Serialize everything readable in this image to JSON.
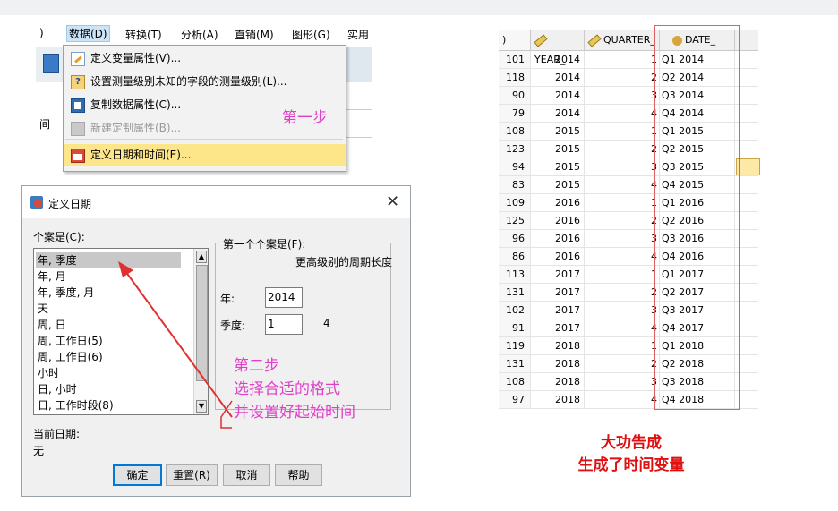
{
  "menu": {
    "bar_items": [
      ")",
      "数据(D)",
      "转换(T)",
      "分析(A)",
      "直销(M)",
      "图形(G)",
      "实用"
    ],
    "grid_label": "间",
    "dropdown_items": [
      {
        "label": "定义变量属性(V)...",
        "icon": "define-variable-properties-icon",
        "disabled": false
      },
      {
        "label": "设置测量级别未知的字段的测量级别(L)...",
        "icon": "measure-level-icon",
        "disabled": false
      },
      {
        "label": "复制数据属性(C)...",
        "icon": "copy-data-properties-icon",
        "disabled": false
      },
      {
        "label": "新建定制属性(B)...",
        "icon": "custom-attribute-icon",
        "disabled": true
      },
      {
        "label": "定义日期和时间(E)...",
        "icon": "define-dates-icon",
        "disabled": false
      }
    ],
    "step_label": "第一步"
  },
  "dialog": {
    "title": "定义日期",
    "close_glyph": "✕",
    "cases_label": "个案是(C):",
    "case_options": [
      "年, 季度",
      "年, 月",
      "年, 季度, 月",
      "天",
      "周, 日",
      "周, 工作日(5)",
      "周, 工作日(6)",
      "小时",
      "日, 小时",
      "日, 工作时段(8)"
    ],
    "selected_option": "年, 季度",
    "first_case_legend": "第一个个案是(F):",
    "higher_period_label": "更高级别的周期长度",
    "year_label": "年:",
    "year_value": "2014",
    "quarter_label": "季度:",
    "quarter_value": "1",
    "quarter_period": "4",
    "current_dates_label": "当前日期:",
    "current_dates_value": "无",
    "buttons": {
      "ok": "确定",
      "reset": "重置(R)",
      "cancel": "取消",
      "help": "帮助"
    },
    "step_lines": [
      "第二步",
      "选择合适的格式",
      "并设置好起始时间"
    ]
  },
  "grid": {
    "headers": {
      "first": ")",
      "year": "YEAR_",
      "quarter": "QUARTER_",
      "date": "DATE_"
    },
    "rows": [
      {
        "id": "101",
        "year": "2014",
        "quarter": "1",
        "date": "Q1 2014"
      },
      {
        "id": "118",
        "year": "2014",
        "quarter": "2",
        "date": "Q2 2014"
      },
      {
        "id": "90",
        "year": "2014",
        "quarter": "3",
        "date": "Q3 2014"
      },
      {
        "id": "79",
        "year": "2014",
        "quarter": "4",
        "date": "Q4 2014"
      },
      {
        "id": "108",
        "year": "2015",
        "quarter": "1",
        "date": "Q1 2015"
      },
      {
        "id": "123",
        "year": "2015",
        "quarter": "2",
        "date": "Q2 2015"
      },
      {
        "id": "94",
        "year": "2015",
        "quarter": "3",
        "date": "Q3 2015"
      },
      {
        "id": "83",
        "year": "2015",
        "quarter": "4",
        "date": "Q4 2015"
      },
      {
        "id": "109",
        "year": "2016",
        "quarter": "1",
        "date": "Q1 2016"
      },
      {
        "id": "125",
        "year": "2016",
        "quarter": "2",
        "date": "Q2 2016"
      },
      {
        "id": "96",
        "year": "2016",
        "quarter": "3",
        "date": "Q3 2016"
      },
      {
        "id": "86",
        "year": "2016",
        "quarter": "4",
        "date": "Q4 2016"
      },
      {
        "id": "113",
        "year": "2017",
        "quarter": "1",
        "date": "Q1 2017"
      },
      {
        "id": "131",
        "year": "2017",
        "quarter": "2",
        "date": "Q2 2017"
      },
      {
        "id": "102",
        "year": "2017",
        "quarter": "3",
        "date": "Q3 2017"
      },
      {
        "id": "91",
        "year": "2017",
        "quarter": "4",
        "date": "Q4 2017"
      },
      {
        "id": "119",
        "year": "2018",
        "quarter": "1",
        "date": "Q1 2018"
      },
      {
        "id": "131",
        "year": "2018",
        "quarter": "2",
        "date": "Q2 2018"
      },
      {
        "id": "108",
        "year": "2018",
        "quarter": "3",
        "date": "Q3 2018"
      },
      {
        "id": "97",
        "year": "2018",
        "quarter": "4",
        "date": "Q4 2018"
      }
    ]
  },
  "result_lines": [
    "大功告成",
    "生成了时间变量"
  ],
  "colors": {
    "annotation_magenta": "#e040c8",
    "result_red": "#e01010",
    "highlight_yellow": "#fde58a",
    "arrow_red": "#e03030"
  }
}
